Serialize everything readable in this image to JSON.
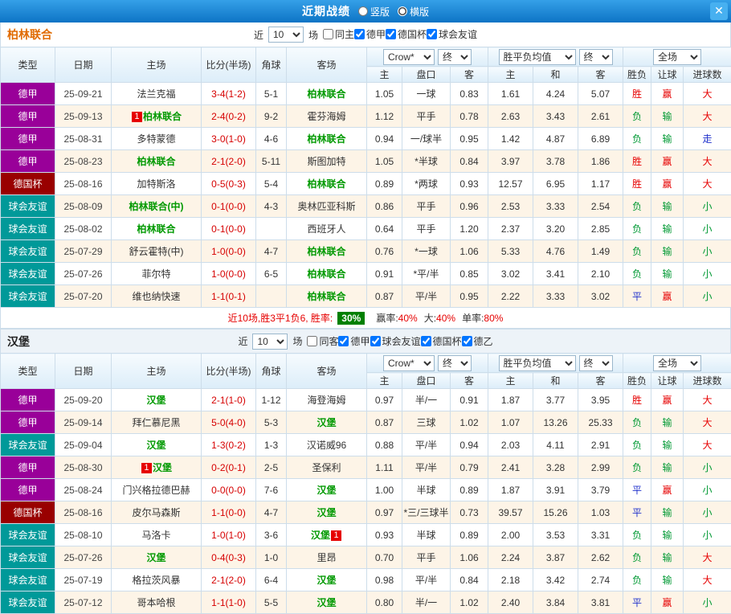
{
  "topbar": {
    "title": "近期战绩",
    "views": [
      {
        "label": "竖版",
        "selected": false
      },
      {
        "label": "横版",
        "selected": true
      }
    ],
    "close_glyph": "✕"
  },
  "columns": {
    "type": "类型",
    "date": "日期",
    "home": "主场",
    "score": "比分(半场)",
    "corner": "角球",
    "away": "客场",
    "sub": [
      "主",
      "盘口",
      "客",
      "主",
      "和",
      "客",
      "胜负",
      "让球",
      "进球数"
    ]
  },
  "controls": {
    "near": "近",
    "games": "10",
    "unit": "场",
    "company": "Crow*",
    "final": "终",
    "avg": "胜平负均值",
    "scope": "全场"
  },
  "league_colors": {
    "德甲": "#990099",
    "德国杯": "#990000",
    "球会友谊": "#009999",
    "德乙": "#667700"
  },
  "value_colors": {
    "胜": "#e60000",
    "负": "#009933",
    "平": "#2233cc",
    "赢": "#e60000",
    "输": "#009933",
    "大": "#e60000",
    "小": "#009933",
    "走": "#2233cc"
  },
  "colors": {
    "topbar_blue": "#0d74c5",
    "focus_team_green": "#009900",
    "score_red": "#d60000",
    "team1_orange": "#e06a00",
    "alt_row_cream": "#fdf4e7",
    "win_rate_badge_green": "#008000"
  },
  "sections": [
    {
      "team": "柏林联合",
      "filters": [
        {
          "label": "同主",
          "checked": false
        },
        {
          "label": "德甲",
          "checked": true
        },
        {
          "label": "德国杯",
          "checked": true
        },
        {
          "label": "球会友谊",
          "checked": true
        }
      ],
      "rows": [
        {
          "type": "德甲",
          "date": "25-09-21",
          "home": "法兰克福",
          "score": "3-4(1-2)",
          "corner": "5-1",
          "away": "柏林联合",
          "away_focus": true,
          "o1": "1.05",
          "hcap": "一球",
          "o2": "0.83",
          "a1": "1.61",
          "a2": "4.24",
          "a3": "5.07",
          "res": "胜",
          "letr": "赢",
          "goal": "大"
        },
        {
          "type": "德甲",
          "date": "25-09-13",
          "home": "柏林联合",
          "home_focus": true,
          "home_badge": "1",
          "score": "2-4(0-2)",
          "corner": "9-2",
          "away": "霍芬海姆",
          "o1": "1.12",
          "hcap": "平手",
          "o2": "0.78",
          "a1": "2.63",
          "a2": "3.43",
          "a3": "2.61",
          "res": "负",
          "letr": "输",
          "goal": "大"
        },
        {
          "type": "德甲",
          "date": "25-08-31",
          "home": "多特蒙德",
          "score": "3-0(1-0)",
          "corner": "4-6",
          "away": "柏林联合",
          "away_focus": true,
          "o1": "0.94",
          "hcap": "一/球半",
          "o2": "0.95",
          "a1": "1.42",
          "a2": "4.87",
          "a3": "6.89",
          "res": "负",
          "letr": "输",
          "goal": "走"
        },
        {
          "type": "德甲",
          "date": "25-08-23",
          "home": "柏林联合",
          "home_focus": true,
          "score": "2-1(2-0)",
          "corner": "5-11",
          "away": "斯图加特",
          "o1": "1.05",
          "hcap": "*半球",
          "o2": "0.84",
          "a1": "3.97",
          "a2": "3.78",
          "a3": "1.86",
          "res": "胜",
          "letr": "赢",
          "goal": "大"
        },
        {
          "type": "德国杯",
          "date": "25-08-16",
          "home": "加特斯洛",
          "score": "0-5(0-3)",
          "corner": "5-4",
          "away": "柏林联合",
          "away_focus": true,
          "o1": "0.89",
          "hcap": "*两球",
          "o2": "0.93",
          "a1": "12.57",
          "a2": "6.95",
          "a3": "1.17",
          "res": "胜",
          "letr": "赢",
          "goal": "大"
        },
        {
          "type": "球会友谊",
          "date": "25-08-09",
          "home": "柏林联合(中)",
          "home_focus": true,
          "score": "0-1(0-0)",
          "corner": "4-3",
          "away": "奥林匹亚科斯",
          "o1": "0.86",
          "hcap": "平手",
          "o2": "0.96",
          "a1": "2.53",
          "a2": "3.33",
          "a3": "2.54",
          "res": "负",
          "letr": "输",
          "goal": "小"
        },
        {
          "type": "球会友谊",
          "date": "25-08-02",
          "home": "柏林联合",
          "home_focus": true,
          "score": "0-1(0-0)",
          "corner": "",
          "away": "西班牙人",
          "o1": "0.64",
          "hcap": "平手",
          "o2": "1.20",
          "a1": "2.37",
          "a2": "3.20",
          "a3": "2.85",
          "res": "负",
          "letr": "输",
          "goal": "小"
        },
        {
          "type": "球会友谊",
          "date": "25-07-29",
          "home": "舒云霍特(中)",
          "score": "1-0(0-0)",
          "corner": "4-7",
          "away": "柏林联合",
          "away_focus": true,
          "o1": "0.76",
          "hcap": "*一球",
          "o2": "1.06",
          "a1": "5.33",
          "a2": "4.76",
          "a3": "1.49",
          "res": "负",
          "letr": "输",
          "goal": "小"
        },
        {
          "type": "球会友谊",
          "date": "25-07-26",
          "home": "菲尔特",
          "score": "1-0(0-0)",
          "corner": "6-5",
          "away": "柏林联合",
          "away_focus": true,
          "o1": "0.91",
          "hcap": "*平/半",
          "o2": "0.85",
          "a1": "3.02",
          "a2": "3.41",
          "a3": "2.10",
          "res": "负",
          "letr": "输",
          "goal": "小"
        },
        {
          "type": "球会友谊",
          "date": "25-07-20",
          "home": "维也纳快速",
          "score": "1-1(0-1)",
          "corner": "",
          "away": "柏林联合",
          "away_focus": true,
          "o1": "0.87",
          "hcap": "平/半",
          "o2": "0.95",
          "a1": "2.22",
          "a2": "3.33",
          "a3": "3.02",
          "res": "平",
          "letr": "赢",
          "goal": "小"
        }
      ],
      "summary": {
        "prefix": "近10场,胜3平1负6, 胜率:",
        "win_rate": "30%",
        "stats": [
          {
            "label": "赢率:",
            "value": "40%"
          },
          {
            "label": "大:",
            "value": "40%"
          },
          {
            "label": "单率:",
            "value": "80%"
          }
        ]
      }
    },
    {
      "team": "汉堡",
      "filters": [
        {
          "label": "同客",
          "checked": false
        },
        {
          "label": "德甲",
          "checked": true
        },
        {
          "label": "球会友谊",
          "checked": true
        },
        {
          "label": "德国杯",
          "checked": true
        },
        {
          "label": "德乙",
          "checked": true
        }
      ],
      "rows": [
        {
          "type": "德甲",
          "date": "25-09-20",
          "home": "汉堡",
          "home_focus": true,
          "score": "2-1(1-0)",
          "corner": "1-12",
          "away": "海登海姆",
          "o1": "0.97",
          "hcap": "半/一",
          "o2": "0.91",
          "a1": "1.87",
          "a2": "3.77",
          "a3": "3.95",
          "res": "胜",
          "letr": "赢",
          "goal": "大"
        },
        {
          "type": "德甲",
          "date": "25-09-14",
          "home": "拜仁慕尼黑",
          "score": "5-0(4-0)",
          "corner": "5-3",
          "away": "汉堡",
          "away_focus": true,
          "o1": "0.87",
          "hcap": "三球",
          "o2": "1.02",
          "a1": "1.07",
          "a2": "13.26",
          "a3": "25.33",
          "res": "负",
          "letr": "输",
          "goal": "大"
        },
        {
          "type": "球会友谊",
          "date": "25-09-04",
          "home": "汉堡",
          "home_focus": true,
          "score": "1-3(0-2)",
          "corner": "1-3",
          "away": "汉诺威96",
          "o1": "0.88",
          "hcap": "平/半",
          "o2": "0.94",
          "a1": "2.03",
          "a2": "4.11",
          "a3": "2.91",
          "res": "负",
          "letr": "输",
          "goal": "大"
        },
        {
          "type": "德甲",
          "date": "25-08-30",
          "home": "汉堡",
          "home_focus": true,
          "home_badge": "1",
          "score": "0-2(0-1)",
          "corner": "2-5",
          "away": "圣保利",
          "o1": "1.11",
          "hcap": "平/半",
          "o2": "0.79",
          "a1": "2.41",
          "a2": "3.28",
          "a3": "2.99",
          "res": "负",
          "letr": "输",
          "goal": "小"
        },
        {
          "type": "德甲",
          "date": "25-08-24",
          "home": "门兴格拉德巴赫",
          "score": "0-0(0-0)",
          "corner": "7-6",
          "away": "汉堡",
          "away_focus": true,
          "o1": "1.00",
          "hcap": "半球",
          "o2": "0.89",
          "a1": "1.87",
          "a2": "3.91",
          "a3": "3.79",
          "res": "平",
          "letr": "赢",
          "goal": "小"
        },
        {
          "type": "德国杯",
          "date": "25-08-16",
          "home": "皮尔马森斯",
          "score": "1-1(0-0)",
          "corner": "4-7",
          "away": "汉堡",
          "away_focus": true,
          "o1": "0.97",
          "hcap": "*三/三球半",
          "o2": "0.73",
          "a1": "39.57",
          "a2": "15.26",
          "a3": "1.03",
          "res": "平",
          "letr": "输",
          "goal": "小"
        },
        {
          "type": "球会友谊",
          "date": "25-08-10",
          "home": "马洛卡",
          "score": "1-0(1-0)",
          "corner": "3-6",
          "away": "汉堡",
          "away_focus": true,
          "away_badge": "1",
          "o1": "0.93",
          "hcap": "半球",
          "o2": "0.89",
          "a1": "2.00",
          "a2": "3.53",
          "a3": "3.31",
          "res": "负",
          "letr": "输",
          "goal": "小"
        },
        {
          "type": "球会友谊",
          "date": "25-07-26",
          "home": "汉堡",
          "home_focus": true,
          "score": "0-4(0-3)",
          "corner": "1-0",
          "away": "里昂",
          "o1": "0.70",
          "hcap": "平手",
          "o2": "1.06",
          "a1": "2.24",
          "a2": "3.87",
          "a3": "2.62",
          "res": "负",
          "letr": "输",
          "goal": "大"
        },
        {
          "type": "球会友谊",
          "date": "25-07-19",
          "home": "格拉茨风暴",
          "score": "2-1(2-0)",
          "corner": "6-4",
          "away": "汉堡",
          "away_focus": true,
          "o1": "0.98",
          "hcap": "平/半",
          "o2": "0.84",
          "a1": "2.18",
          "a2": "3.42",
          "a3": "2.74",
          "res": "负",
          "letr": "输",
          "goal": "大"
        },
        {
          "type": "球会友谊",
          "date": "25-07-12",
          "home": "哥本哈根",
          "score": "1-1(1-0)",
          "corner": "5-5",
          "away": "汉堡",
          "away_focus": true,
          "o1": "0.80",
          "hcap": "半/一",
          "o2": "1.02",
          "a1": "2.40",
          "a2": "3.84",
          "a3": "3.81",
          "res": "平",
          "letr": "赢",
          "goal": "小"
        }
      ]
    }
  ]
}
